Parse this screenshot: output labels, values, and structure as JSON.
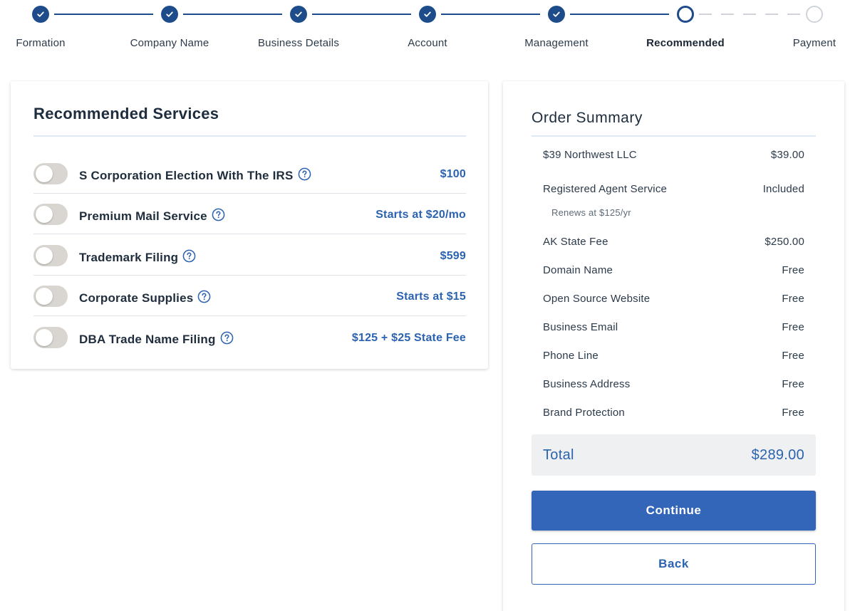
{
  "stepper": {
    "steps": [
      {
        "label": "Formation",
        "status": "complete"
      },
      {
        "label": "Company Name",
        "status": "complete"
      },
      {
        "label": "Business Details",
        "status": "complete"
      },
      {
        "label": "Account",
        "status": "complete"
      },
      {
        "label": "Management",
        "status": "complete"
      },
      {
        "label": "Recommended",
        "status": "current"
      },
      {
        "label": "Payment",
        "status": "pending"
      }
    ]
  },
  "services": {
    "title": "Recommended Services",
    "items": [
      {
        "name": "S Corporation Election With The IRS",
        "price": "$100",
        "enabled": false
      },
      {
        "name": "Premium Mail Service",
        "price": "Starts at $20/mo",
        "enabled": false
      },
      {
        "name": "Trademark Filing",
        "price": "$599",
        "enabled": false
      },
      {
        "name": "Corporate Supplies",
        "price": "Starts at $15",
        "enabled": false
      },
      {
        "name": "DBA Trade Name Filing",
        "price": "$125 + $25 State Fee",
        "enabled": false
      }
    ]
  },
  "summary": {
    "title": "Order Summary",
    "rows": [
      {
        "label": "$39 Northwest LLC",
        "value": "$39.00"
      },
      {
        "label": "Registered Agent Service",
        "value": "Included"
      },
      {
        "label": "AK State Fee",
        "value": "$250.00"
      },
      {
        "label": "Domain Name",
        "value": "Free"
      },
      {
        "label": "Open Source Website",
        "value": "Free"
      },
      {
        "label": "Business Email",
        "value": "Free"
      },
      {
        "label": "Phone Line",
        "value": "Free"
      },
      {
        "label": "Business Address",
        "value": "Free"
      },
      {
        "label": "Brand Protection",
        "value": "Free"
      }
    ],
    "renewal_note": "Renews at $125/yr",
    "total_label": "Total",
    "total_value": "$289.00",
    "continue_label": "Continue",
    "back_label": "Back"
  },
  "colors": {
    "primary": "#1e4c8a",
    "accent_blue": "#2b63b0",
    "button_blue": "#3365b8",
    "toggle_off": "#d9d5d0"
  },
  "icons": {
    "step_complete": "check-icon",
    "service_help": "question-circle-icon"
  }
}
